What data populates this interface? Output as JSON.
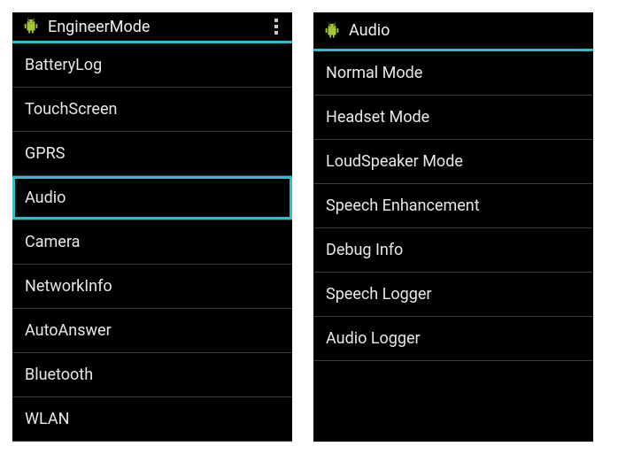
{
  "left": {
    "title": "EngineerMode",
    "items": [
      {
        "label": "BatteryLog",
        "selected": false
      },
      {
        "label": "TouchScreen",
        "selected": false
      },
      {
        "label": "GPRS",
        "selected": false
      },
      {
        "label": "Audio",
        "selected": true
      },
      {
        "label": "Camera",
        "selected": false
      },
      {
        "label": "NetworkInfo",
        "selected": false
      },
      {
        "label": "AutoAnswer",
        "selected": false
      },
      {
        "label": "Bluetooth",
        "selected": false
      },
      {
        "label": "WLAN",
        "selected": false
      }
    ]
  },
  "right": {
    "title": "Audio",
    "items": [
      {
        "label": "Normal Mode",
        "selected": false
      },
      {
        "label": "Headset Mode",
        "selected": false
      },
      {
        "label": "LoudSpeaker Mode",
        "selected": false
      },
      {
        "label": "Speech Enhancement",
        "selected": false
      },
      {
        "label": "Debug Info",
        "selected": false
      },
      {
        "label": "Speech Logger",
        "selected": false
      },
      {
        "label": "Audio Logger",
        "selected": false
      }
    ]
  }
}
